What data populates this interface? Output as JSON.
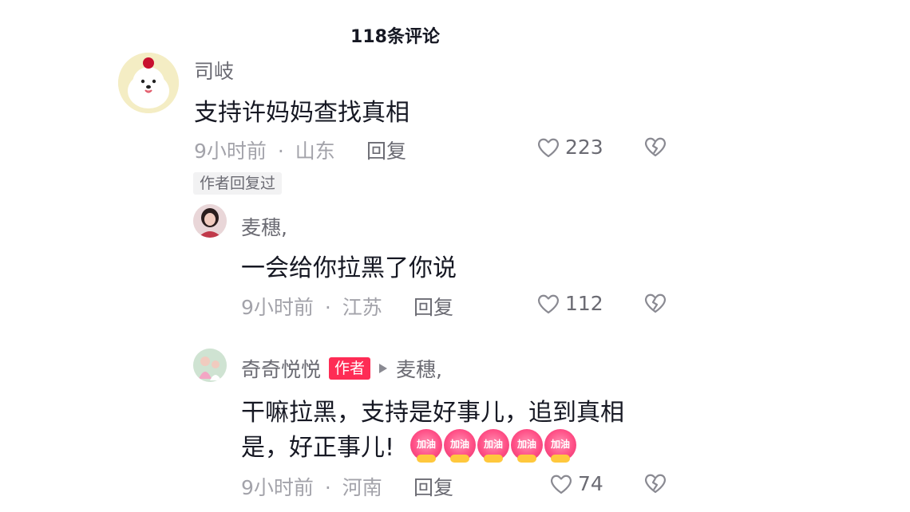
{
  "header": {
    "title": "118条评论"
  },
  "comments": [
    {
      "username": "司岐",
      "text": "支持许妈妈查找真相",
      "time": "9小时前",
      "separator": "·",
      "location": "山东",
      "reply_label": "回复",
      "likes": "223",
      "author_replied_badge": "作者回复过"
    },
    {
      "username": "麦穗,",
      "text": "一会给你拉黑了你说",
      "time": "9小时前",
      "separator": "·",
      "location": "江苏",
      "reply_label": "回复",
      "likes": "112"
    },
    {
      "username": "奇奇悦悦",
      "author_tag": "作者",
      "reply_to": "麦穗,",
      "text_line1": "干嘛拉黑，支持是好事儿，追到真相",
      "text_line2": "是，好正事儿!",
      "emoji_label": "加油",
      "emojis": [
        "加油",
        "加油",
        "加油",
        "加油",
        "加油"
      ],
      "time": "9小时前",
      "separator": "·",
      "location": "河南",
      "reply_label": "回复",
      "likes": "74"
    }
  ],
  "icons": {
    "like": "heart-outline-icon",
    "dislike": "broken-heart-icon",
    "reply_arrow": "triangle-right-icon"
  },
  "colors": {
    "author_tag_bg": "#fe2c55",
    "text_primary": "#161823",
    "text_secondary": "#6b6b73",
    "text_meta": "#a3a3aa"
  }
}
